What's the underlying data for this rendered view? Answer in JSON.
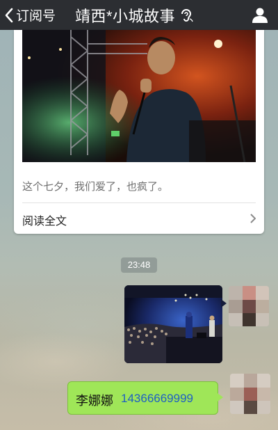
{
  "header": {
    "back_label": "订阅号",
    "title": "靖西*小城故事",
    "icons": [
      "chevron-left-icon",
      "earpiece-icon",
      "user-icon"
    ]
  },
  "article": {
    "description": "这个七夕，我们爱了，也疯了。",
    "read_more_label": "阅读全文"
  },
  "timestamp": "23:48",
  "messages": [
    {
      "type": "image",
      "content": "concert photo"
    },
    {
      "type": "text",
      "name": "李娜娜",
      "phone": "14366669999"
    }
  ],
  "colors": {
    "topbar": "#2c2e32",
    "bubble_green": "#9fe658",
    "link_blue": "#1d5fc4"
  }
}
